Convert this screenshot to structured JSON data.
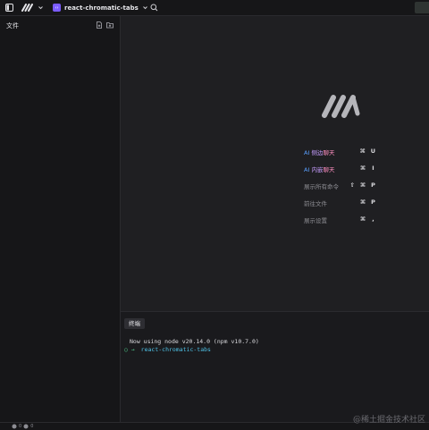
{
  "header": {
    "project_name": "react-chromatic-tabs"
  },
  "sidebar": {
    "title": "文件"
  },
  "shortcuts": [
    {
      "label_ai": "AI",
      "label_a": "侧边",
      "label_b": "聊天",
      "keys": [
        "⌘",
        "U"
      ]
    },
    {
      "label_ai": "AI",
      "label_a": "内嵌",
      "label_b": "聊天",
      "keys": [
        "⌘",
        "I"
      ]
    },
    {
      "label": "展示所有命令",
      "keys": [
        "⇧",
        "⌘",
        "P"
      ]
    },
    {
      "label": "前往文件",
      "keys": [
        "⌘",
        "P"
      ]
    },
    {
      "label": "展示设置",
      "keys": [
        "⌘",
        ","
      ]
    }
  ],
  "terminal": {
    "tab_label": "终端",
    "line1": "Now using node v20.14.0 (npm v10.7.0)",
    "prompt_symbol": "○ →",
    "cwd": "react-chromatic-tabs"
  },
  "statusbar": {
    "errors": "0",
    "warnings": "0"
  },
  "watermark": "@稀土掘金技术社区",
  "colors": {
    "accent_purple": "#7b5cff",
    "ai_blue": "#5aa0ff",
    "terminal_cyan": "#4fc3e8"
  }
}
